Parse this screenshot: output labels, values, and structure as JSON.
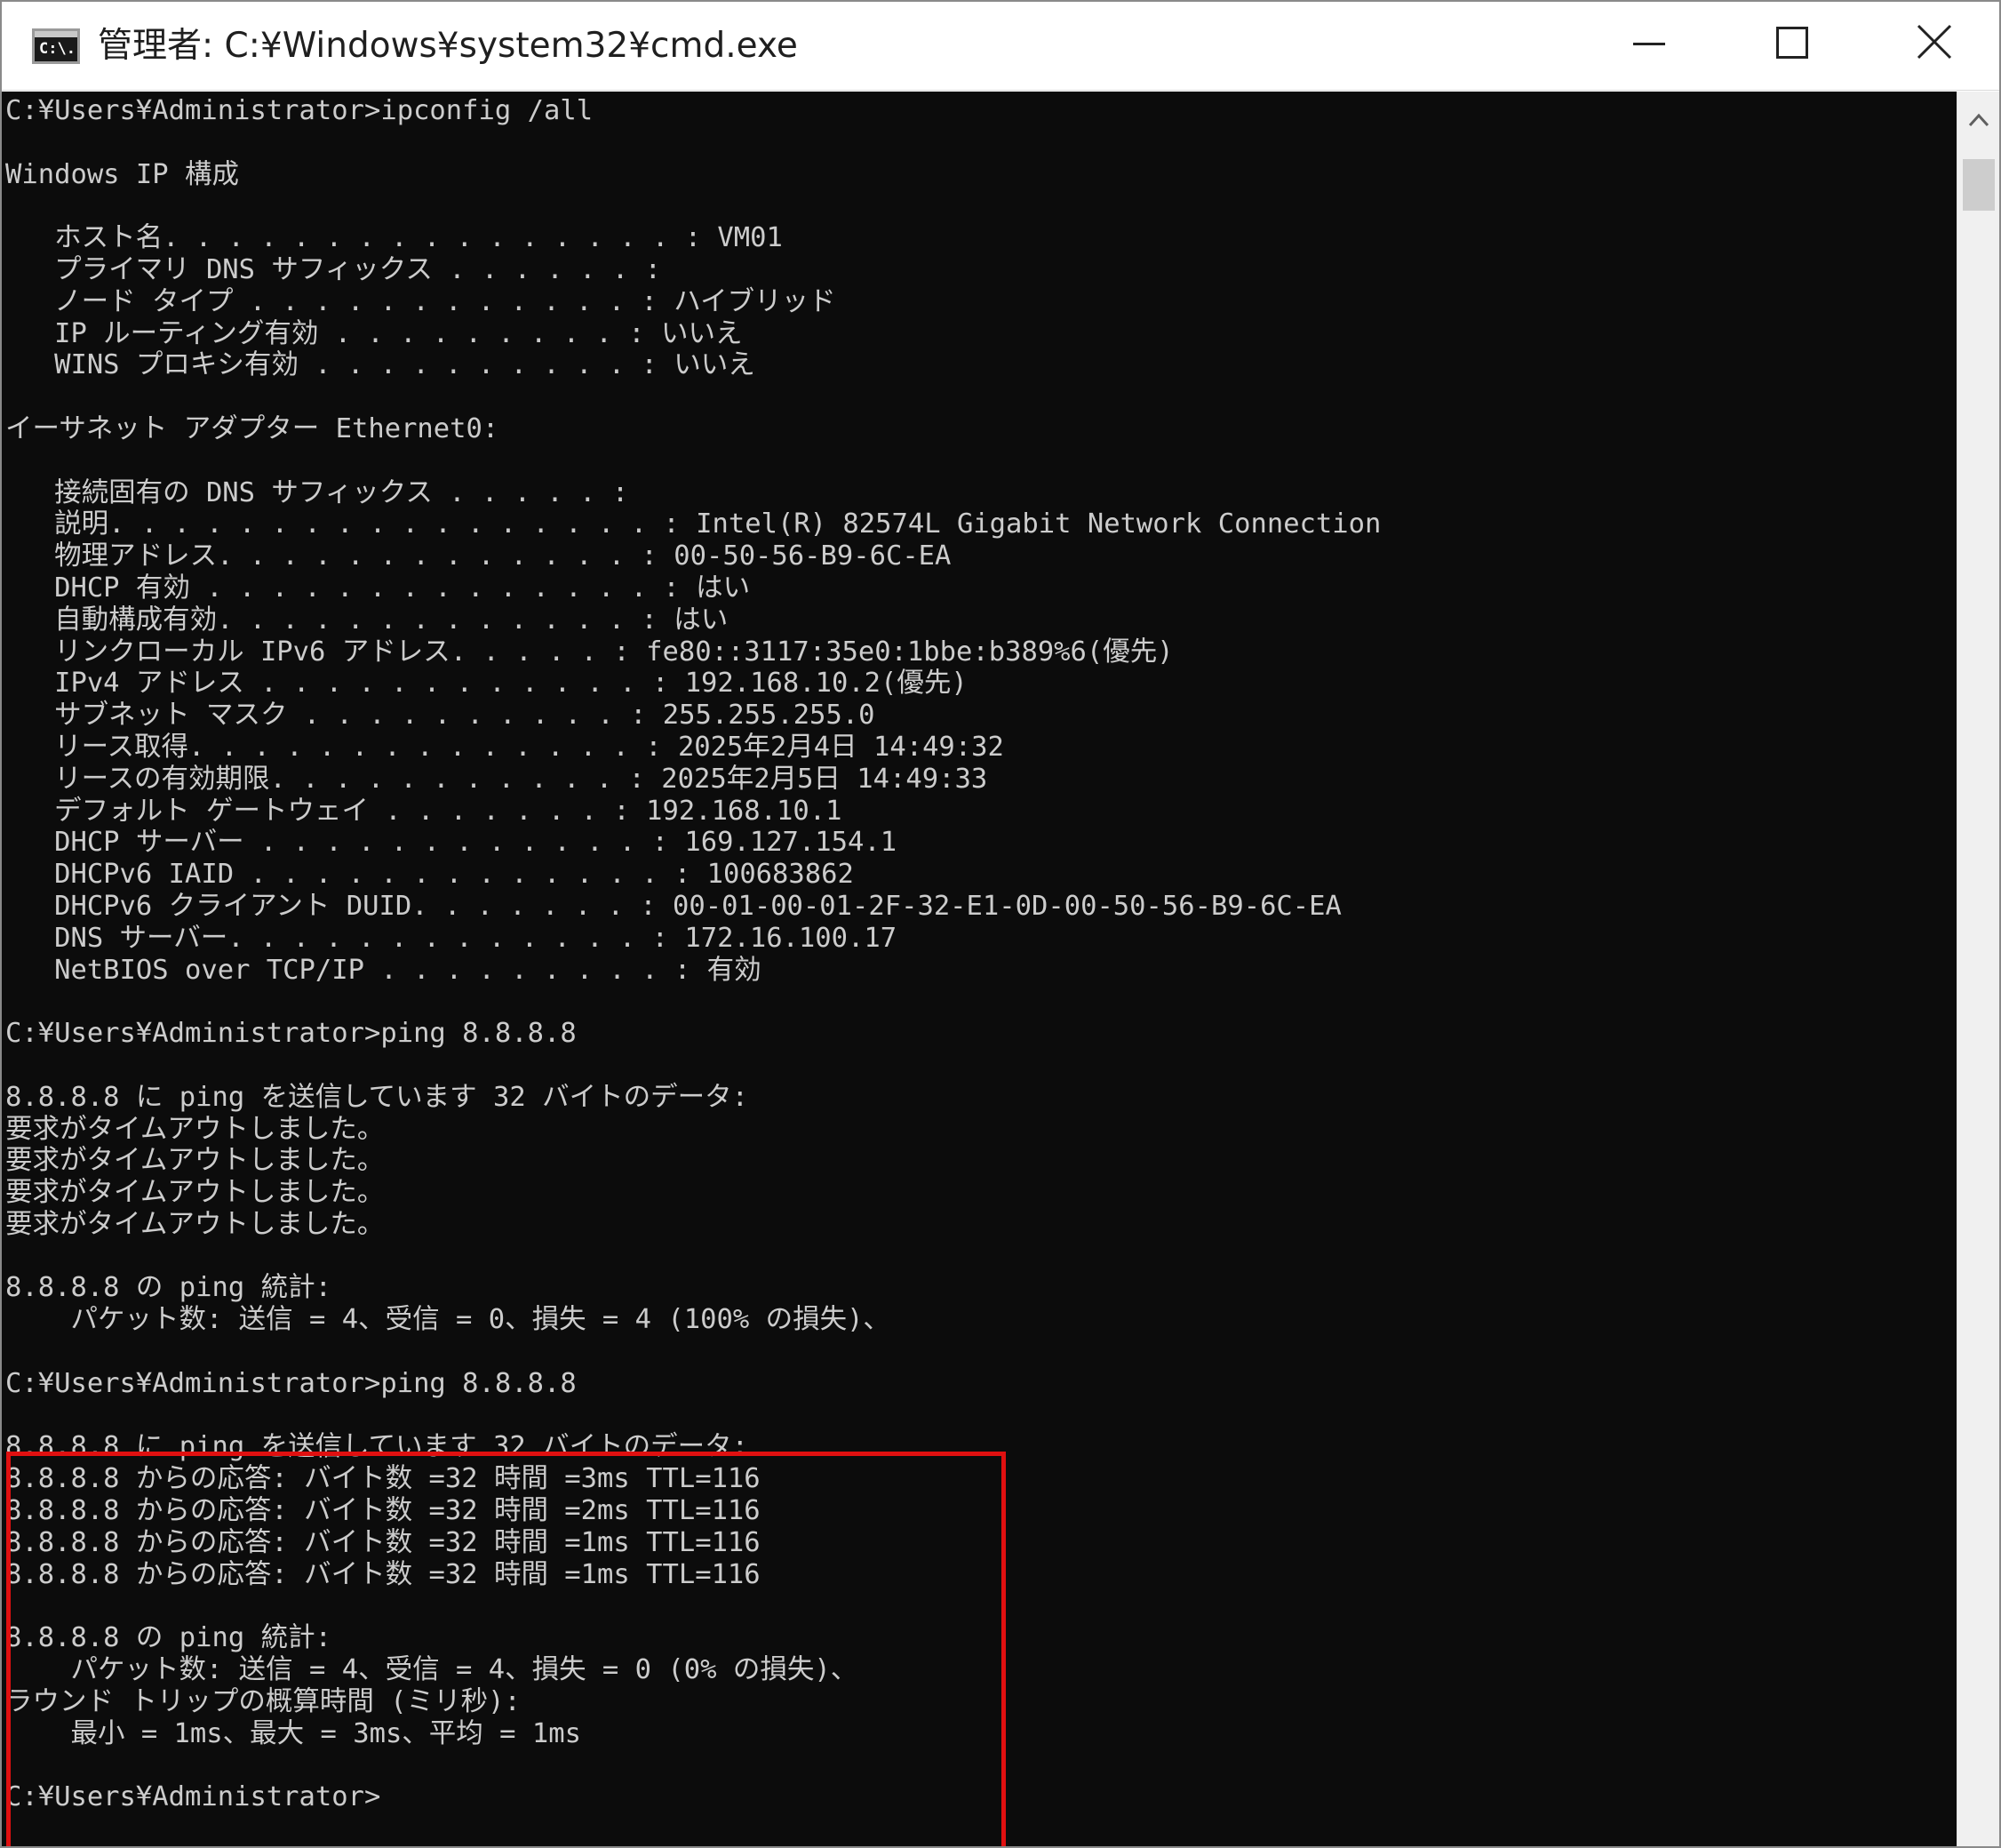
{
  "window": {
    "title": "管理者: C:¥Windows¥system32¥cmd.exe",
    "icon": "cmd-icon",
    "icon_text": "C:\\."
  },
  "controls": {
    "minimize": "minimize-icon",
    "maximize": "maximize-icon",
    "close": "close-icon"
  },
  "scrollbar": {
    "up_arrow": "chevron-up-icon"
  },
  "console": {
    "background": "#0c0c0c",
    "foreground": "#cccccc",
    "highlight_color": "#e01010",
    "lines": [
      "C:¥Users¥Administrator>ipconfig /all",
      "",
      "Windows IP 構成",
      "",
      "   ホスト名. . . . . . . . . . . . . . . . : VM01",
      "   プライマリ DNS サフィックス . . . . . . :",
      "   ノード タイプ . . . . . . . . . . . . : ハイブリッド",
      "   IP ルーティング有効 . . . . . . . . . : いいえ",
      "   WINS プロキシ有効 . . . . . . . . . . : いいえ",
      "",
      "イーサネット アダプター Ethernet0:",
      "",
      "   接続固有の DNS サフィックス . . . . . :",
      "   説明. . . . . . . . . . . . . . . . . : Intel(R) 82574L Gigabit Network Connection",
      "   物理アドレス. . . . . . . . . . . . . : 00-50-56-B9-6C-EA",
      "   DHCP 有効 . . . . . . . . . . . . . . : はい",
      "   自動構成有効. . . . . . . . . . . . . : はい",
      "   リンクローカル IPv6 アドレス. . . . . : fe80::3117:35e0:1bbe:b389%6(優先)",
      "   IPv4 アドレス . . . . . . . . . . . . : 192.168.10.2(優先)",
      "   サブネット マスク . . . . . . . . . . : 255.255.255.0",
      "   リース取得. . . . . . . . . . . . . . : 2025年2月4日 14:49:32",
      "   リースの有効期限. . . . . . . . . . . : 2025年2月5日 14:49:33",
      "   デフォルト ゲートウェイ . . . . . . . : 192.168.10.1",
      "   DHCP サーバー . . . . . . . . . . . . : 169.127.154.1",
      "   DHCPv6 IAID . . . . . . . . . . . . . : 100683862",
      "   DHCPv6 クライアント DUID. . . . . . . : 00-01-00-01-2F-32-E1-0D-00-50-56-B9-6C-EA",
      "   DNS サーバー. . . . . . . . . . . . . : 172.16.100.17",
      "   NetBIOS over TCP/IP . . . . . . . . . : 有効",
      "",
      "C:¥Users¥Administrator>ping 8.8.8.8",
      "",
      "8.8.8.8 に ping を送信しています 32 バイトのデータ:",
      "要求がタイムアウトしました。",
      "要求がタイムアウトしました。",
      "要求がタイムアウトしました。",
      "要求がタイムアウトしました。",
      "",
      "8.8.8.8 の ping 統計:",
      "    パケット数: 送信 = 4、受信 = 0、損失 = 4 (100% の損失)、",
      "",
      "C:¥Users¥Administrator>ping 8.8.8.8",
      "",
      "8.8.8.8 に ping を送信しています 32 バイトのデータ:",
      "8.8.8.8 からの応答: バイト数 =32 時間 =3ms TTL=116",
      "8.8.8.8 からの応答: バイト数 =32 時間 =2ms TTL=116",
      "8.8.8.8 からの応答: バイト数 =32 時間 =1ms TTL=116",
      "8.8.8.8 からの応答: バイト数 =32 時間 =1ms TTL=116",
      "",
      "8.8.8.8 の ping 統計:",
      "    パケット数: 送信 = 4、受信 = 4、損失 = 0 (0% の損失)、",
      "ラウンド トリップの概算時間 (ミリ秒):",
      "    最小 = 1ms、最大 = 3ms、平均 = 1ms",
      "",
      "C:¥Users¥Administrator>"
    ]
  }
}
